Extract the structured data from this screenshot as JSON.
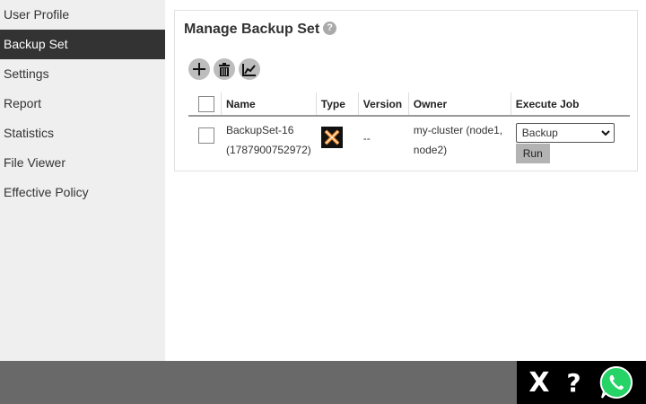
{
  "sidebar": {
    "items": [
      {
        "label": "User Profile"
      },
      {
        "label": "Backup Set"
      },
      {
        "label": "Settings"
      },
      {
        "label": "Report"
      },
      {
        "label": "Statistics"
      },
      {
        "label": "File Viewer"
      },
      {
        "label": "Effective Policy"
      }
    ],
    "active": "Backup Set"
  },
  "panel": {
    "title": "Manage Backup Set",
    "help_glyph": "?"
  },
  "toolbar": {
    "icons": [
      "add-icon",
      "trash-icon",
      "chart-icon"
    ]
  },
  "table": {
    "headers": {
      "name": "Name",
      "type": "Type",
      "version": "Version",
      "owner": "Owner",
      "execute_job": "Execute Job"
    },
    "rows": [
      {
        "name_line1": "BackupSet-16",
        "name_line2": "(1787900752972)",
        "type_icon": "x-orange-icon",
        "version": "--",
        "owner_line1": "my-cluster (node1,",
        "owner_line2": "node2)",
        "job_selected": "Backup",
        "run_label": "Run"
      }
    ]
  },
  "footer": {
    "close_glyph": "X",
    "help_glyph": "?",
    "chat_icon": "whatsapp-icon"
  },
  "colors": {
    "sidebar_bg": "#efefef",
    "sidebar_active": "#333333",
    "footer_bg": "#696969",
    "footer_box": "#000000",
    "whatsapp": "#25d366",
    "type_icon_accent": "#f08a24"
  }
}
